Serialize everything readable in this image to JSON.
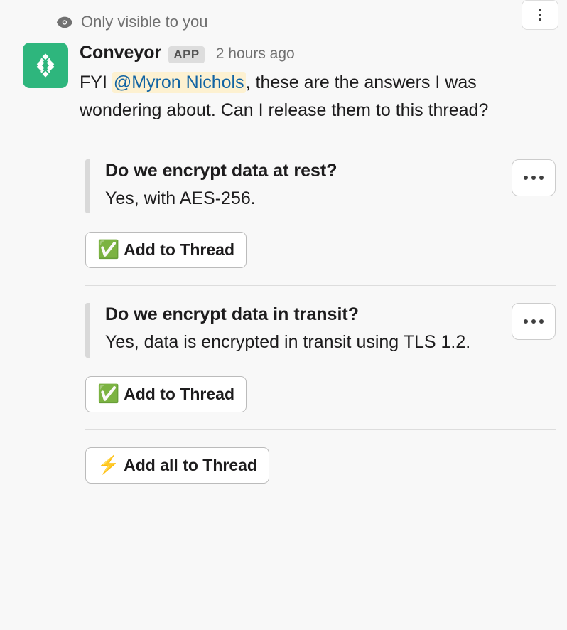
{
  "visibility": {
    "label": "Only visible to you"
  },
  "message": {
    "author": "Conveyor",
    "badge": "APP",
    "timestamp": "2 hours ago",
    "text_prefix": "FYI ",
    "mention": "@Myron Nichols",
    "text_suffix": ", these are the answers I was wondering about. Can I release them to this thread?"
  },
  "cards": [
    {
      "question": "Do we encrypt data at rest?",
      "answer": "Yes, with AES-256.",
      "action_emoji": "✅",
      "action_label": "Add to Thread"
    },
    {
      "question": "Do we encrypt data in transit?",
      "answer": "Yes, data is encrypted in transit using TLS 1.2.",
      "action_emoji": "✅",
      "action_label": "Add to Thread"
    }
  ],
  "bulk_action": {
    "emoji": "⚡",
    "label": "Add all to Thread"
  }
}
